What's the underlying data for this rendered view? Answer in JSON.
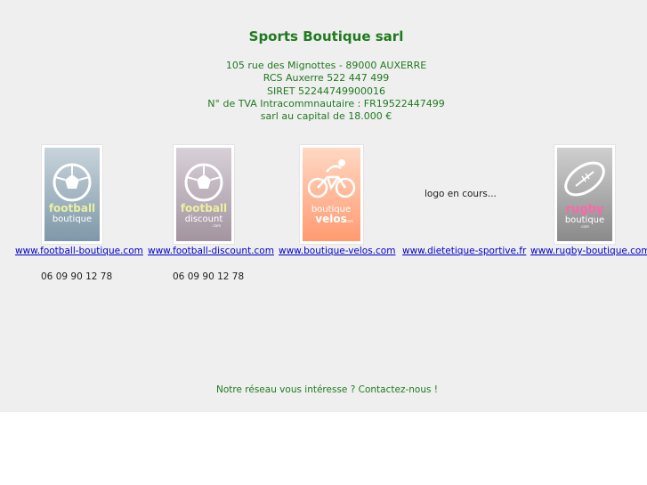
{
  "header": {
    "title": "Sports Boutique sarl",
    "address_lines": [
      "105 rue des Mignottes - 89000 AUXERRE",
      "RCS Auxerre 522 447 499",
      "SIRET 52244749900016",
      "N° de TVA Intracommnautaire : FR19522447499",
      "sarl au capital de 18.000 €"
    ]
  },
  "sites": [
    {
      "logo_text": [
        "football",
        "boutique"
      ],
      "logo_icon": "soccer-ball-icon",
      "url": "www.football-boutique.com",
      "phone": "06 09 90 12 78",
      "colors": {
        "top": "#c8d4dc",
        "bottom": "#7f98a8",
        "word1": "#e9f0a0",
        "word2": "#ffffff"
      }
    },
    {
      "logo_text": [
        "football",
        "discount"
      ],
      "logo_icon": "soccer-ball-icon",
      "logo_small": ".com",
      "url": "www.football-discount.com",
      "phone": "06 09 90 12 78",
      "colors": {
        "top": "#d8d0d8",
        "bottom": "#a394a0",
        "word1": "#ecf0a0",
        "word2": "#ffffff"
      }
    },
    {
      "logo_text": [
        "boutique",
        "velos"
      ],
      "logo_icon": "cyclist-icon",
      "logo_small": ".com",
      "url": "www.boutique-velos.com",
      "colors": {
        "top": "#ffd8c4",
        "bottom": "#ff9a70",
        "word1": "#ffffff",
        "word2": "#ffffff"
      }
    },
    {
      "logo_placeholder": "logo en cours...",
      "url": "www.dietetique-sportive.fr"
    },
    {
      "logo_text": [
        "rugby",
        "boutique"
      ],
      "logo_icon": "rugby-ball-icon",
      "logo_small": ".com",
      "url": "www.rugby-boutique.com",
      "colors": {
        "top": "#cfcfcf",
        "bottom": "#8a8a8a",
        "word1": "#ff66aa",
        "word2": "#ffffff"
      }
    }
  ],
  "footer": {
    "contact_text": "Notre réseau vous intéresse ? Contactez-nous !"
  }
}
